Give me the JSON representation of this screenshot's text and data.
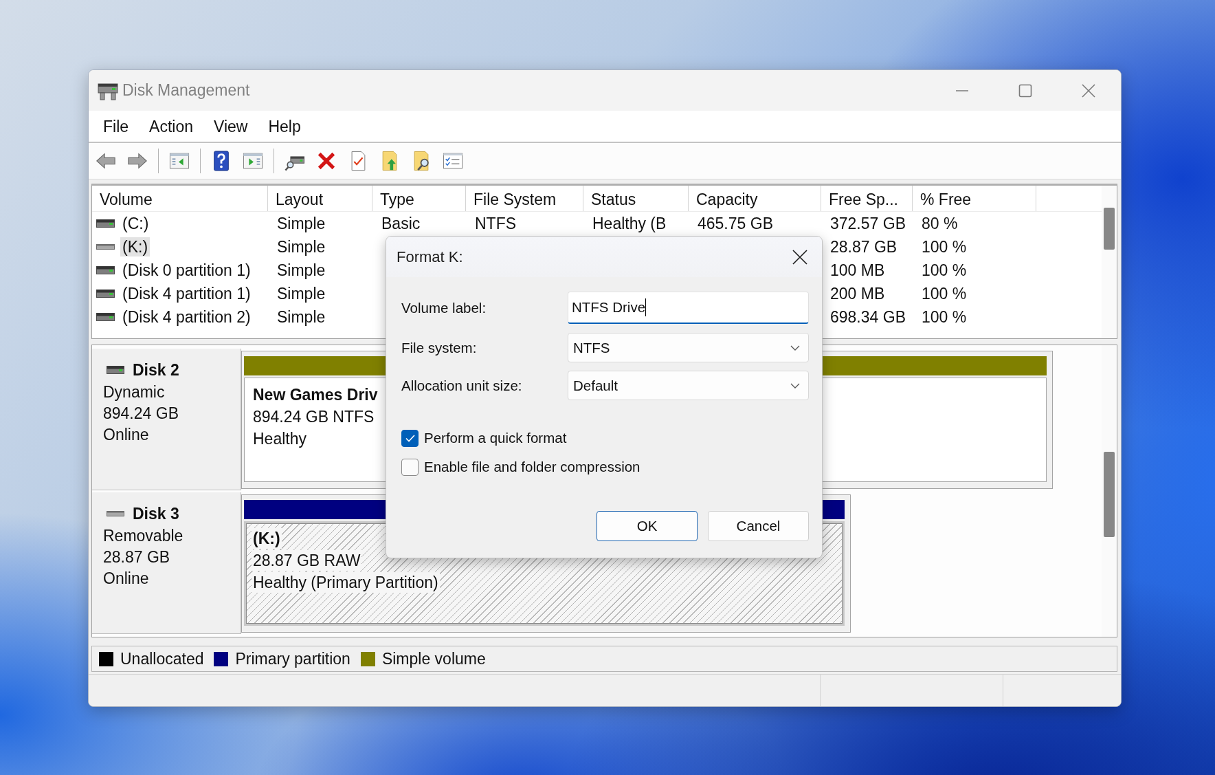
{
  "window": {
    "title": "Disk Management"
  },
  "menu": [
    "File",
    "Action",
    "View",
    "Help"
  ],
  "table": {
    "columns": [
      "Volume",
      "Layout",
      "Type",
      "File System",
      "Status",
      "Capacity",
      "Free Sp...",
      "% Free"
    ],
    "rows": [
      {
        "kind": "fixed",
        "selected": false,
        "volume": "(C:)",
        "layout": "Simple",
        "type": "Basic",
        "file_system": "NTFS",
        "status": "Healthy (B",
        "capacity": "465.75 GB",
        "free_space": "372.57 GB",
        "percent_free": "80 %"
      },
      {
        "kind": "removable",
        "selected": true,
        "volume": "(K:)",
        "layout": "Simple",
        "free_space": "28.87 GB",
        "percent_free": "100 %"
      },
      {
        "kind": "fixed",
        "selected": false,
        "volume": "(Disk 0 partition 1)",
        "layout": "Simple",
        "free_space": "100 MB",
        "percent_free": "100 %"
      },
      {
        "kind": "fixed",
        "selected": false,
        "volume": "(Disk 4 partition 1)",
        "layout": "Simple",
        "free_space": "200 MB",
        "percent_free": "100 %"
      },
      {
        "kind": "fixed",
        "selected": false,
        "volume": "(Disk 4 partition 2)",
        "layout": "Simple",
        "free_space": "698.34 GB",
        "percent_free": "100 %"
      }
    ]
  },
  "disks": [
    {
      "kind": "fixed",
      "name": "Disk 2",
      "type": "Dynamic",
      "size": "894.24 GB",
      "status": "Online",
      "volumes": [
        {
          "name": "New Games Driv",
          "details": "894.24 GB NTFS",
          "status": "Healthy",
          "color": "#808000",
          "selected": false
        }
      ]
    },
    {
      "kind": "removable",
      "name": "Disk 3",
      "type": "Removable",
      "size": "28.87 GB",
      "status": "Online",
      "volumes": [
        {
          "name": "(K:)",
          "details": "28.87 GB RAW",
          "status": "Healthy (Primary Partition)",
          "color": "#000080",
          "selected": true
        }
      ]
    }
  ],
  "legend": [
    {
      "label": "Unallocated",
      "color": "#000000"
    },
    {
      "label": "Primary partition",
      "color": "#000080"
    },
    {
      "label": "Simple volume",
      "color": "#808000"
    }
  ],
  "dialog": {
    "title": "Format K:",
    "fields": [
      {
        "kind": "text",
        "label": "Volume label:",
        "value": "NTFS Drive",
        "focused": true
      },
      {
        "kind": "dropdown",
        "label": "File system:",
        "value": "NTFS"
      },
      {
        "kind": "dropdown",
        "label": "Allocation unit size:",
        "value": "Default"
      }
    ],
    "options": [
      {
        "label": "Perform a quick format",
        "checked": true
      },
      {
        "label": "Enable file and folder compression",
        "checked": false
      }
    ],
    "buttons": [
      {
        "label": "OK",
        "default": true
      },
      {
        "label": "Cancel",
        "default": false
      }
    ]
  }
}
